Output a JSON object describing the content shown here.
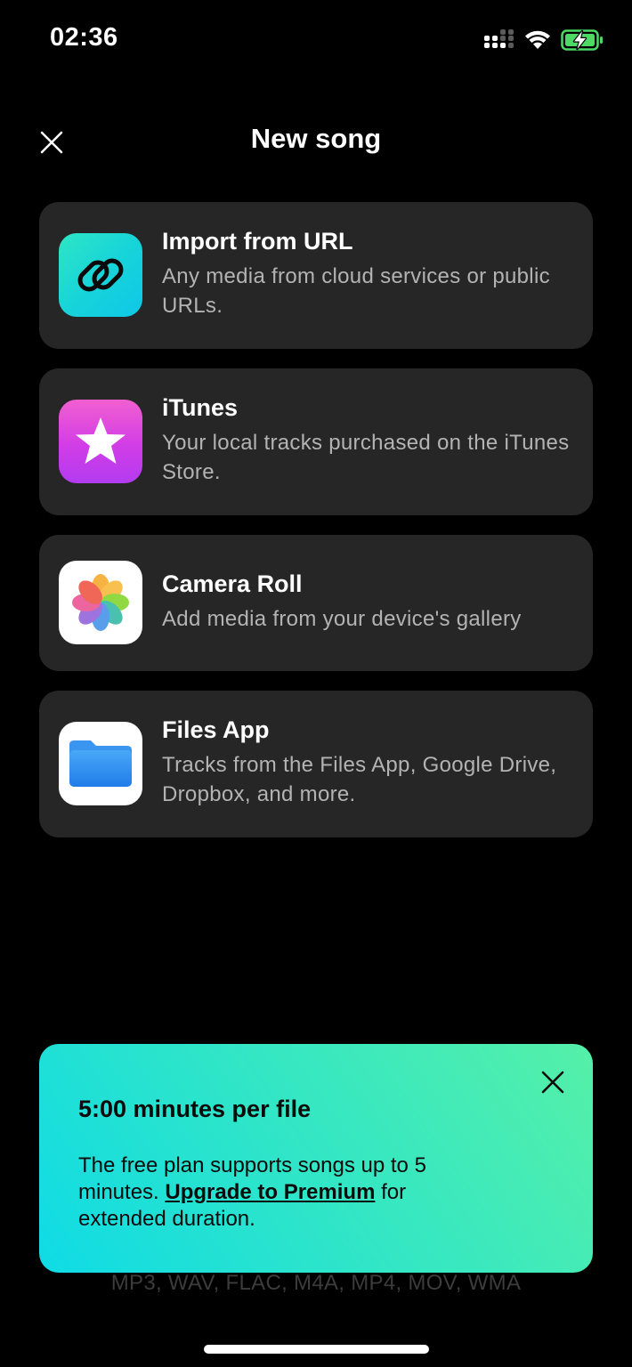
{
  "status_bar": {
    "time": "02:36",
    "icons": [
      "cellular-signal-icon",
      "wifi-icon",
      "battery-charging-icon"
    ]
  },
  "header": {
    "title": "New song",
    "close_icon": "close-icon"
  },
  "options": [
    {
      "title": "Import from URL",
      "description": "Any media from cloud services or public URLs.",
      "icon": "link-icon"
    },
    {
      "title": "iTunes",
      "description": "Your local tracks purchased on the iTunes Store.",
      "icon": "itunes-star-icon"
    },
    {
      "title": "Camera Roll",
      "description": "Add media from your device's gallery",
      "icon": "photos-icon"
    },
    {
      "title": "Files App",
      "description": "Tracks from the Files App, Google Drive, Dropbox, and more.",
      "icon": "folder-icon"
    }
  ],
  "promo": {
    "title": "5:00 minutes per file",
    "body_before": "The free plan supports songs up to 5 minutes. ",
    "link_text": "Upgrade to Premium",
    "body_after": " for extended duration."
  },
  "formats": "MP3, WAV, FLAC, M4A, MP4, MOV, WMA",
  "colors": {
    "background": "#000000",
    "card": "#262626",
    "description": "#b3b3b3",
    "battery": "#4cd964",
    "promo_start": "#0fdbe6",
    "promo_end": "#55f0a8"
  }
}
